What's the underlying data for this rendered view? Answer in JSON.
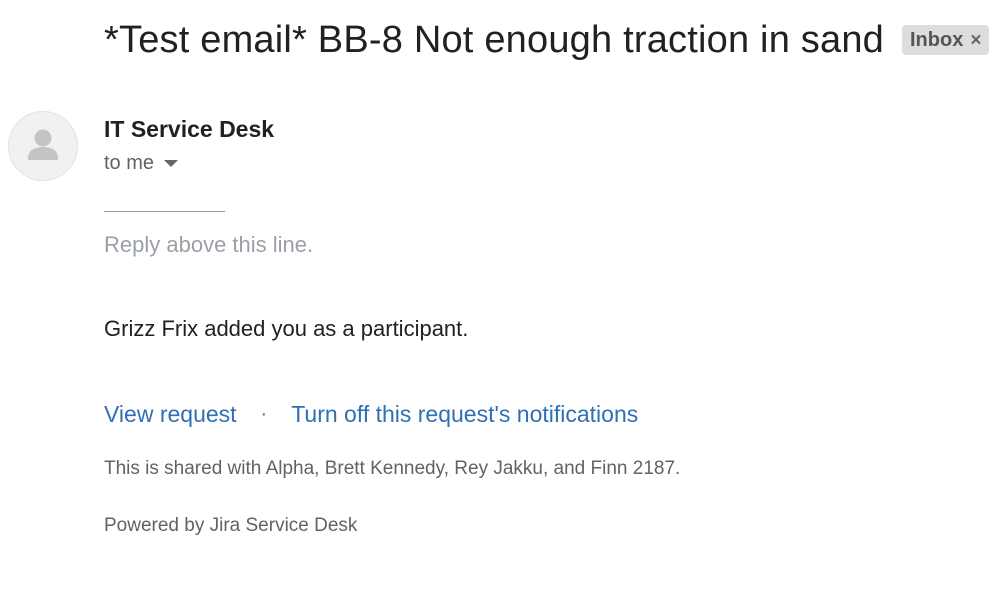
{
  "email": {
    "subject": "*Test email* BB-8 Not enough traction in sand",
    "label_chip": {
      "label": "Inbox",
      "close_glyph": "×"
    },
    "sender": {
      "name": "IT Service Desk",
      "avatar_icon": "person-icon"
    },
    "recipient": {
      "text": "to me",
      "dropdown_icon": "caret-down-icon"
    },
    "body": {
      "reply_marker": "Reply above this line.",
      "message": "Grizz Frix added you as a participant.",
      "actions": {
        "view_request": "View request",
        "separator": "·",
        "turn_off_notifications": "Turn off this request's notifications"
      },
      "shared_notice": "This is shared with Alpha, Brett Kennedy, Rey Jakku, and Finn 2187.",
      "footer": "Powered by Jira Service Desk"
    }
  },
  "colors": {
    "link": "#2f6fb5",
    "chip_background": "#dddddd",
    "muted_text": "#9aa0a6"
  }
}
